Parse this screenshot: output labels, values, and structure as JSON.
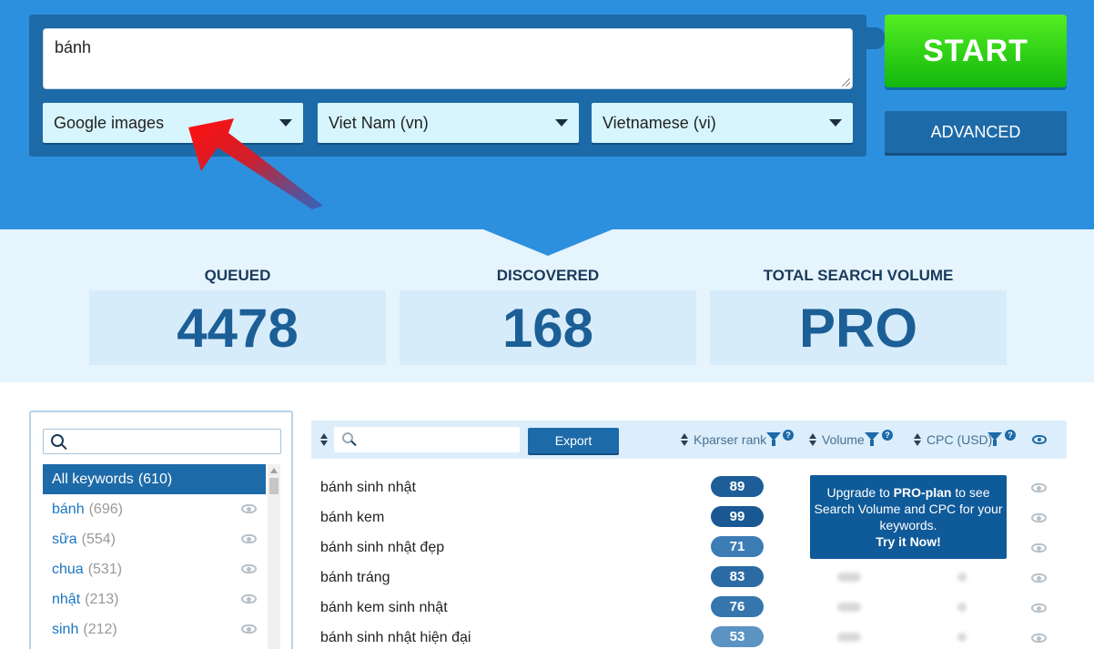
{
  "search": {
    "query": "bánh",
    "engine": "Google images",
    "country": "Viet Nam (vn)",
    "language": "Vietnamese (vi)"
  },
  "buttons": {
    "start": "START",
    "advanced": "ADVANCED",
    "export": "Export"
  },
  "stats": {
    "queued_label": "QUEUED",
    "queued_value": "4478",
    "discovered_label": "DISCOVERED",
    "discovered_value": "168",
    "volume_label": "TOTAL SEARCH VOLUME",
    "volume_value": "PRO"
  },
  "sidebar": {
    "items": [
      {
        "label": "All keywords",
        "count": "(610)"
      },
      {
        "label": "bánh",
        "count": "(696)"
      },
      {
        "label": "sữa",
        "count": "(554)"
      },
      {
        "label": "chua",
        "count": "(531)"
      },
      {
        "label": "nhật",
        "count": "(213)"
      },
      {
        "label": "sinh",
        "count": "(212)"
      }
    ]
  },
  "table": {
    "columns": {
      "rank": "Kparser rank",
      "volume": "Volume",
      "cpc": "CPC (USD)"
    },
    "rows": [
      {
        "keyword": "bánh sinh nhật",
        "rank": "89"
      },
      {
        "keyword": "bánh kem",
        "rank": "99"
      },
      {
        "keyword": "bánh sinh nhật đẹp",
        "rank": "71"
      },
      {
        "keyword": "bánh tráng",
        "rank": "83"
      },
      {
        "keyword": "bánh kem sinh nhật",
        "rank": "76"
      },
      {
        "keyword": "bánh sinh nhật hiện đại",
        "rank": "53"
      }
    ]
  },
  "pro_box": {
    "prefix": "Upgrade to ",
    "plan": "PRO-plan",
    "suffix": " to see Search Volume and CPC for your keywords.",
    "cta": "Try it Now!"
  },
  "colors": {
    "primary_blue": "#2d90de",
    "dark_blue": "#1d6aa8",
    "start_green": "#2dd41a",
    "rank_dark": "#1d5e99",
    "rank_light": "#5b93c2"
  }
}
